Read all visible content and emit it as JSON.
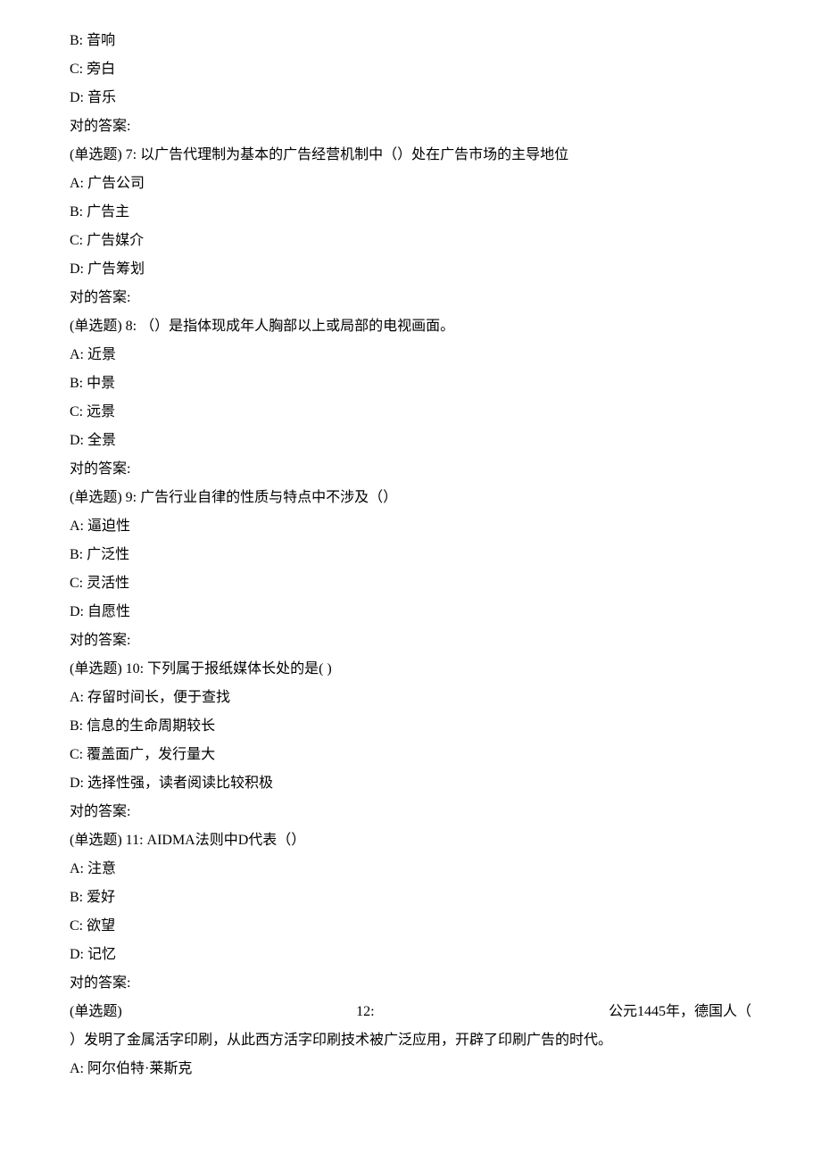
{
  "q6": {
    "B": "B: 音响",
    "C": "C: 旁白",
    "D": "D: 音乐",
    "ans": "对的答案:"
  },
  "q7": {
    "stem": "(单选题) 7: 以广告代理制为基本的广告经营机制中（）处在广告市场的主导地位",
    "A": "A: 广告公司",
    "B": "B: 广告主",
    "C": "C: 广告媒介",
    "D": "D: 广告筹划",
    "ans": "对的答案:"
  },
  "q8": {
    "stem": "(单选题) 8: （）是指体现成年人胸部以上或局部的电视画面。",
    "A": "A: 近景",
    "B": "B: 中景",
    "C": "C: 远景",
    "D": "D: 全景",
    "ans": "对的答案:"
  },
  "q9": {
    "stem": "(单选题) 9: 广告行业自律的性质与特点中不涉及（）",
    "A": "A: 逼迫性",
    "B": "B: 广泛性",
    "C": "C: 灵活性",
    "D": "D: 自愿性",
    "ans": "对的答案:"
  },
  "q10": {
    "stem": "(单选题) 10: 下列属于报纸媒体长处的是( )",
    "A": "A: 存留时间长，便于查找",
    "B": "B: 信息的生命周期较长",
    "C": "C: 覆盖面广，发行量大",
    "D": "D: 选择性强，读者阅读比较积极",
    "ans": "对的答案:"
  },
  "q11": {
    "stem": "(单选题) 11: AIDMA法则中D代表（）",
    "A": "A: 注意",
    "B": "B: 爱好",
    "C": "C: 欲望",
    "D": "D: 记忆",
    "ans": "对的答案:"
  },
  "q12": {
    "stem_a": "(单选题)",
    "stem_b": "12:",
    "stem_c": "公元1445年，德国人（",
    "stem2": "）发明了金属活字印刷，从此西方活字印刷技术被广泛应用，开辟了印刷广告的时代。",
    "A": "A: 阿尔伯特·莱斯克"
  }
}
